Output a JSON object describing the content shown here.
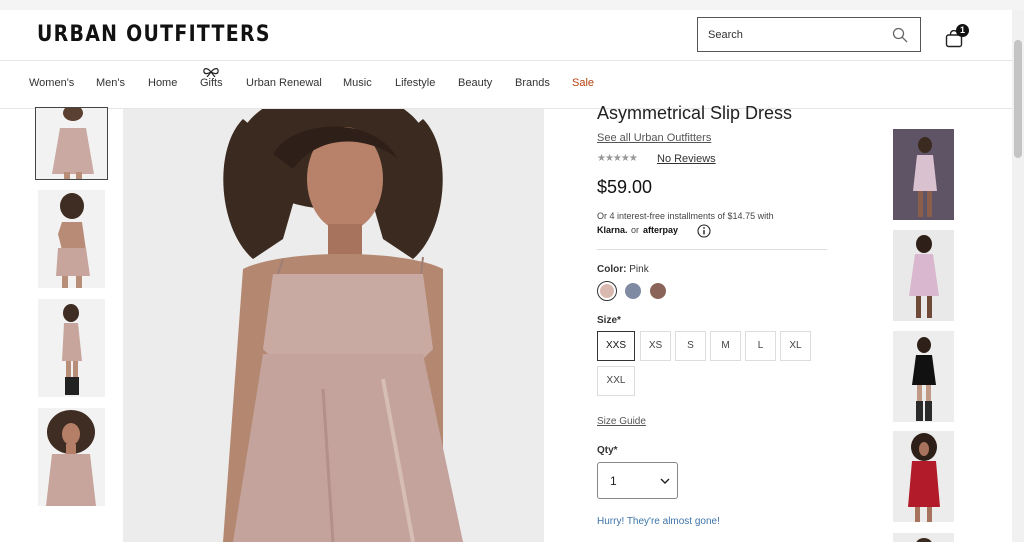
{
  "header": {
    "logo": "URBAN OUTFITTERS",
    "search_placeholder": "Search",
    "cart_count": "1"
  },
  "nav": {
    "items": [
      "Women's",
      "Men's",
      "Home",
      "Gifts",
      "Urban Renewal",
      "Music",
      "Lifestyle",
      "Beauty",
      "Brands",
      "Sale"
    ]
  },
  "product": {
    "title": "Asymmetrical Slip Dress",
    "see_all": "See all Urban Outfitters",
    "stars": "★★★★★",
    "reviews": "No Reviews",
    "price": "$59.00",
    "installments": "Or 4 interest-free installments of $14.75 with",
    "klarna": "Klarna.",
    "or": "or",
    "afterpay": "afterpay",
    "color_label": "Color:",
    "color_value": "Pink",
    "colors": [
      "#d9b8b0",
      "#7f8aa3",
      "#8a6459"
    ],
    "size_label": "Size*",
    "sizes": [
      "XXS",
      "XS",
      "S",
      "M",
      "L",
      "XL",
      "XXL"
    ],
    "selected_size": "XXS",
    "size_guide": "Size Guide",
    "qty_label": "Qty*",
    "qty_value": "1",
    "stock_message": "Hurry! They're almost gone!"
  },
  "colors": {
    "sale": "#b5410e",
    "stock_message": "#3d74a8"
  }
}
